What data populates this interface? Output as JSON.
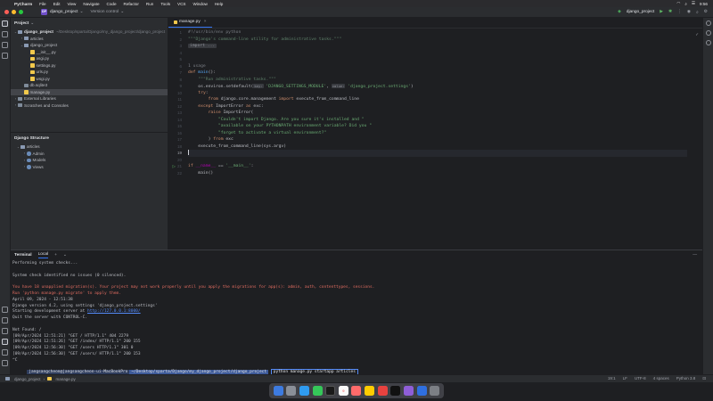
{
  "menubar": {
    "apple": "",
    "items": [
      "PyCharm",
      "File",
      "Edit",
      "View",
      "Navigate",
      "Code",
      "Refactor",
      "Run",
      "Tools",
      "VCS",
      "Window",
      "Help"
    ],
    "clock": "9:56"
  },
  "toolbar": {
    "project_badge": "DP",
    "project_name": "django_project",
    "vcs": "Version control",
    "run_config": "django_project"
  },
  "project_panel": {
    "title": "Project",
    "root": "django_project",
    "root_path": "~/Desktop/sparta/Django/my_django_project/django_project",
    "items": [
      {
        "label": "articles",
        "kind": "folder",
        "depth": 1,
        "arrow": "›"
      },
      {
        "label": "django_project",
        "kind": "folder",
        "depth": 1,
        "arrow": "⌄"
      },
      {
        "label": "__init__.py",
        "kind": "py",
        "depth": 2
      },
      {
        "label": "asgi.py",
        "kind": "py",
        "depth": 2
      },
      {
        "label": "settings.py",
        "kind": "py",
        "depth": 2
      },
      {
        "label": "urls.py",
        "kind": "py",
        "depth": 2
      },
      {
        "label": "wsgi.py",
        "kind": "py",
        "depth": 2
      },
      {
        "label": "db.sqlite3",
        "kind": "db",
        "depth": 1
      },
      {
        "label": "manage.py",
        "kind": "py",
        "depth": 1
      }
    ],
    "external": "External Libraries",
    "scratches": "Scratches and Consoles"
  },
  "structure_panel": {
    "title": "Django Structure",
    "root": "articles",
    "items": [
      "Admin",
      "Models",
      "Views"
    ]
  },
  "editor": {
    "tab": "manage.py",
    "lines": [
      {
        "n": "1",
        "html": "<span class='cm'>#!/usr/bin/env python</span>"
      },
      {
        "n": "2",
        "html": "<span class='doc'>\"\"\"Django's command-line utility for administrative tasks.\"\"\"</span>"
      },
      {
        "n": "3",
        "html": "<span class='fold-box'>import ...</span>"
      },
      {
        "n": "4",
        "html": ""
      },
      {
        "n": "5",
        "html": ""
      },
      {
        "n": "6",
        "html": "<span class='cm'>1 usage</span>"
      },
      {
        "n": "7",
        "html": "<span class='kw'>def </span><span class='fn'>main</span>():"
      },
      {
        "n": "8",
        "html": "    <span class='doc'>\"\"\"Run administrative tasks.\"\"\"</span>"
      },
      {
        "n": "9",
        "html": "    os.environ.setdefault(<span class='ph'>key:</span> <span class='str'>'DJANGO_SETTINGS_MODULE'</span>, <span class='ph'>value:</span> <span class='str'>'django_project.settings'</span>)"
      },
      {
        "n": "10",
        "html": "    <span class='kw'>try</span>:"
      },
      {
        "n": "11",
        "html": "        <span class='kw'>from </span>django.core.management <span class='kw'>import </span>execute_from_command_line"
      },
      {
        "n": "12",
        "html": "    <span class='kw'>except </span>ImportError <span class='kw'>as </span>exc:"
      },
      {
        "n": "13",
        "html": "        <span class='kw'>raise </span>ImportError("
      },
      {
        "n": "14",
        "html": "            <span class='str'>\"Couldn't import Django. Are you sure it's installed and \"</span>"
      },
      {
        "n": "15",
        "html": "            <span class='str'>\"available on your PYTHONPATH environment variable? Did you \"</span>"
      },
      {
        "n": "16",
        "html": "            <span class='str'>\"forget to activate a virtual environment?\"</span>"
      },
      {
        "n": "17",
        "html": "        ) <span class='kw'>from </span>exc"
      },
      {
        "n": "18",
        "html": "    execute_from_command_line(sys.argv)"
      },
      {
        "n": "19",
        "html": "",
        "cur": true
      },
      {
        "n": "20",
        "html": ""
      },
      {
        "n": "21",
        "html": "<span class='kw'>if </span><span class='dund'>__name__</span> == <span class='str'>'__main__'</span>:",
        "run": true
      },
      {
        "n": "22",
        "html": "    main()"
      }
    ]
  },
  "terminal": {
    "tab_title": "Terminal",
    "tab_local": "Local",
    "lines": [
      {
        "t": "Performing system checks..."
      },
      {
        "t": ""
      },
      {
        "t": "System check identified no issues (0 silenced)."
      },
      {
        "t": ""
      },
      {
        "t": "You have 18 unapplied migration(s). Your project may not work properly until you apply the migrations for app(s): admin, auth, contenttypes, sessions.",
        "red": true
      },
      {
        "t": "Run 'python manage.py migrate' to apply them.",
        "red": true
      },
      {
        "t": "April 09, 2024 - 12:51:38"
      },
      {
        "t": "Django version 4.2, using settings 'django_project.settings'"
      },
      {
        "t": "Starting development server at ",
        "link": "http://127.0.0.1:8000/"
      },
      {
        "t": "Quit the server with CONTROL-C."
      },
      {
        "t": ""
      },
      {
        "t": "Not Found: /"
      },
      {
        "t": "[09/Apr/2024 12:51:21] \"GET / HTTP/1.1\" 404 2279"
      },
      {
        "t": "[09/Apr/2024 12:51:26] \"GET /index/ HTTP/1.1\" 200 155"
      },
      {
        "t": "[09/Apr/2024 12:56:30] \"GET /users HTTP/1.1\" 301 0"
      },
      {
        "t": "[09/Apr/2024 12:56:30] \"GET /users/ HTTP/1.1\" 200 153"
      },
      {
        "t": "^C"
      }
    ],
    "prompt_user": "jangsangcheon@jangsangcheon-ui-MacBookPro",
    "prompt_path": "~/Desktop/sparta/Django/my_django_project/django_project",
    "prompt_cmd": "python manage.py startapp articles"
  },
  "statusbar": {
    "crumb_project": "django_project",
    "crumb_file": "manage.py",
    "position": "19:1",
    "line_sep": "LF",
    "encoding": "UTF-8",
    "indent": "4 spaces",
    "interpreter": "Python 3.8"
  },
  "dock": {
    "calendar_day": "9"
  },
  "colors": {
    "accent": "#3574f0",
    "project_badge": "#6f4fc9",
    "error_text": "#e06c60",
    "string": "#6aab73",
    "keyword": "#cf8e6d"
  }
}
